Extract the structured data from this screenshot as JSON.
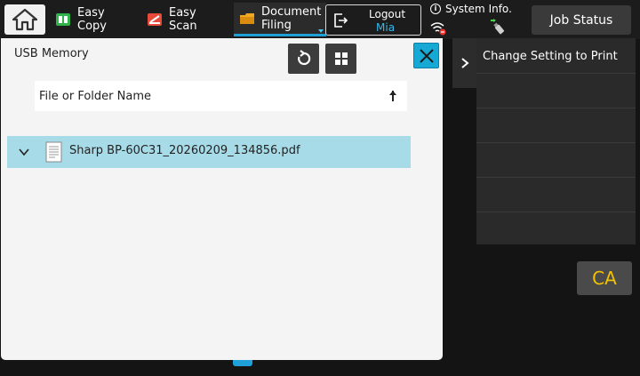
{
  "topbar": {
    "easy_copy": {
      "line1": "Easy",
      "line2": "Copy"
    },
    "easy_scan": {
      "line1": "Easy",
      "line2": "Scan"
    },
    "document_filing": {
      "line1": "Document",
      "line2": "Filing"
    },
    "logout": {
      "label": "Logout",
      "user": "Mia"
    },
    "system_info": "System Info.",
    "job_status": "Job Status"
  },
  "panel": {
    "title": "USB Memory",
    "column_header": "File or Folder Name",
    "files": [
      {
        "name": "Sharp BP-60C31_20260209_134856.pdf",
        "selected": true
      }
    ]
  },
  "side_panel": {
    "title": "Change Setting to Print"
  },
  "ca_button": "CA",
  "colors": {
    "accent": "#17a9d6",
    "selected_row": "#a8dbe8",
    "ca_text": "#f2c200"
  },
  "icons": [
    "home-icon",
    "copy-icon",
    "scan-icon",
    "folder-icon",
    "logout-icon",
    "info-icon",
    "wifi-off-icon",
    "usb-icon",
    "refresh-icon",
    "grid-icon",
    "close-icon",
    "sort-up-icon",
    "chevron-down-icon",
    "file-icon",
    "chevron-right-icon"
  ]
}
